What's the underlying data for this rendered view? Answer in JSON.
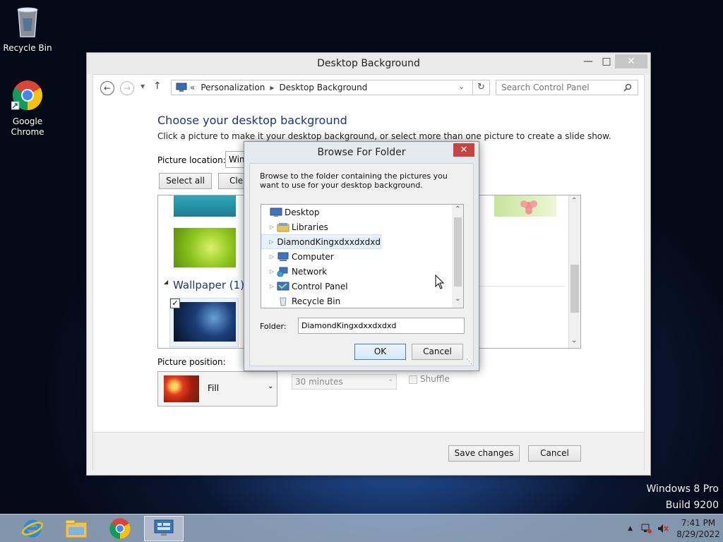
{
  "desktop": {
    "icons": [
      {
        "label": "Recycle Bin"
      },
      {
        "label": "Google Chrome"
      }
    ],
    "watermark_line1": "Windows 8 Pro",
    "watermark_line2": "Build 9200"
  },
  "taskbar": {
    "time": "7:41 PM",
    "date": "8/29/2022"
  },
  "window": {
    "title": "Desktop Background",
    "breadcrumb_prefix": "«",
    "breadcrumb": [
      "Personalization",
      "Desktop Background"
    ],
    "search_placeholder": "Search Control Panel",
    "heading": "Choose your desktop background",
    "description": "Click a picture to make it your desktop background, or select more than one picture to create a slide show.",
    "picture_location_label": "Picture location:",
    "picture_location_value": "Windows Desktop Backgrounds",
    "select_all": "Select all",
    "clear_all": "Clear all",
    "group_title": "Wallpaper (1)",
    "picture_position_label": "Picture position:",
    "picture_position_value": "Fill",
    "interval_value": "30 minutes",
    "shuffle_label": "Shuffle",
    "save_button": "Save changes",
    "cancel_button": "Cancel"
  },
  "dialog": {
    "title": "Browse For Folder",
    "instructions": "Browse to the folder containing the pictures you want to use for your desktop background.",
    "tree": [
      {
        "label": "Desktop",
        "icon": "desktop-icon"
      },
      {
        "label": "Libraries",
        "icon": "libraries-icon"
      },
      {
        "label": "DiamondKingxdxxdxdxd",
        "icon": "user-folder-icon"
      },
      {
        "label": "Computer",
        "icon": "computer-icon"
      },
      {
        "label": "Network",
        "icon": "network-icon"
      },
      {
        "label": "Control Panel",
        "icon": "control-panel-icon"
      },
      {
        "label": "Recycle Bin",
        "icon": "recycle-bin-icon"
      }
    ],
    "folder_label": "Folder:",
    "folder_value": "DiamondKingxdxxdxdxd",
    "ok": "OK",
    "cancel": "Cancel"
  },
  "colors": {
    "heading": "#1e3287",
    "close_red": "#c74242"
  }
}
